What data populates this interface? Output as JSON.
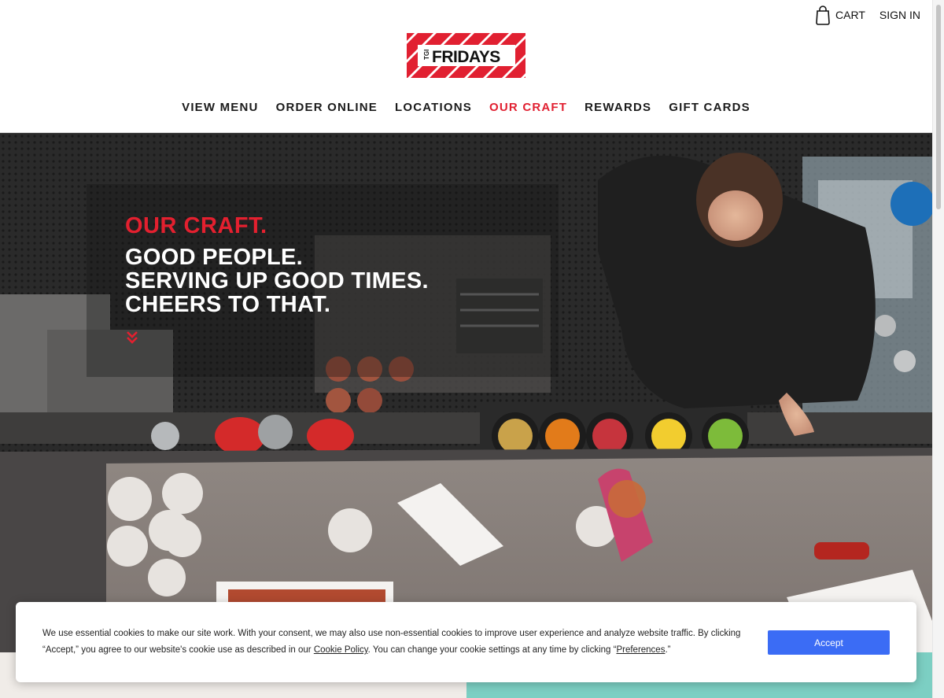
{
  "header": {
    "cart_label": "CART",
    "signin_label": "SIGN IN",
    "logo": {
      "prefix": "TGI",
      "name": "FRIDAYS",
      "stripe_color": "#e12031"
    },
    "nav": [
      {
        "label": "VIEW MENU",
        "active": false
      },
      {
        "label": "ORDER ONLINE",
        "active": false
      },
      {
        "label": "LOCATIONS",
        "active": false
      },
      {
        "label": "OUR CRAFT",
        "active": true
      },
      {
        "label": "REWARDS",
        "active": false
      },
      {
        "label": "GIFT CARDS",
        "active": false
      }
    ]
  },
  "hero": {
    "kicker": "OUR CRAFT.",
    "lines": [
      "GOOD PEOPLE.",
      "SERVING UP GOOD TIMES.",
      "CHEERS TO THAT."
    ],
    "accent_color": "#e3202f"
  },
  "cookie": {
    "text_before_link": "We use essential cookies to make our site work. With your consent, we may also use non-essential cookies to improve user experience and analyze website traffic. By clicking “Accept,” you agree to our website's cookie use as described in our ",
    "policy_link": "Cookie Policy",
    "text_middle": ". You can change your cookie settings at any time by clicking “",
    "preferences_link": "Preferences",
    "text_end": ".”",
    "accept_label": "Accept",
    "accept_color": "#3b6cf5"
  },
  "colors": {
    "brand_red": "#e12031",
    "band_left": "#f0ece8",
    "band_right": "#7ccfc3"
  }
}
